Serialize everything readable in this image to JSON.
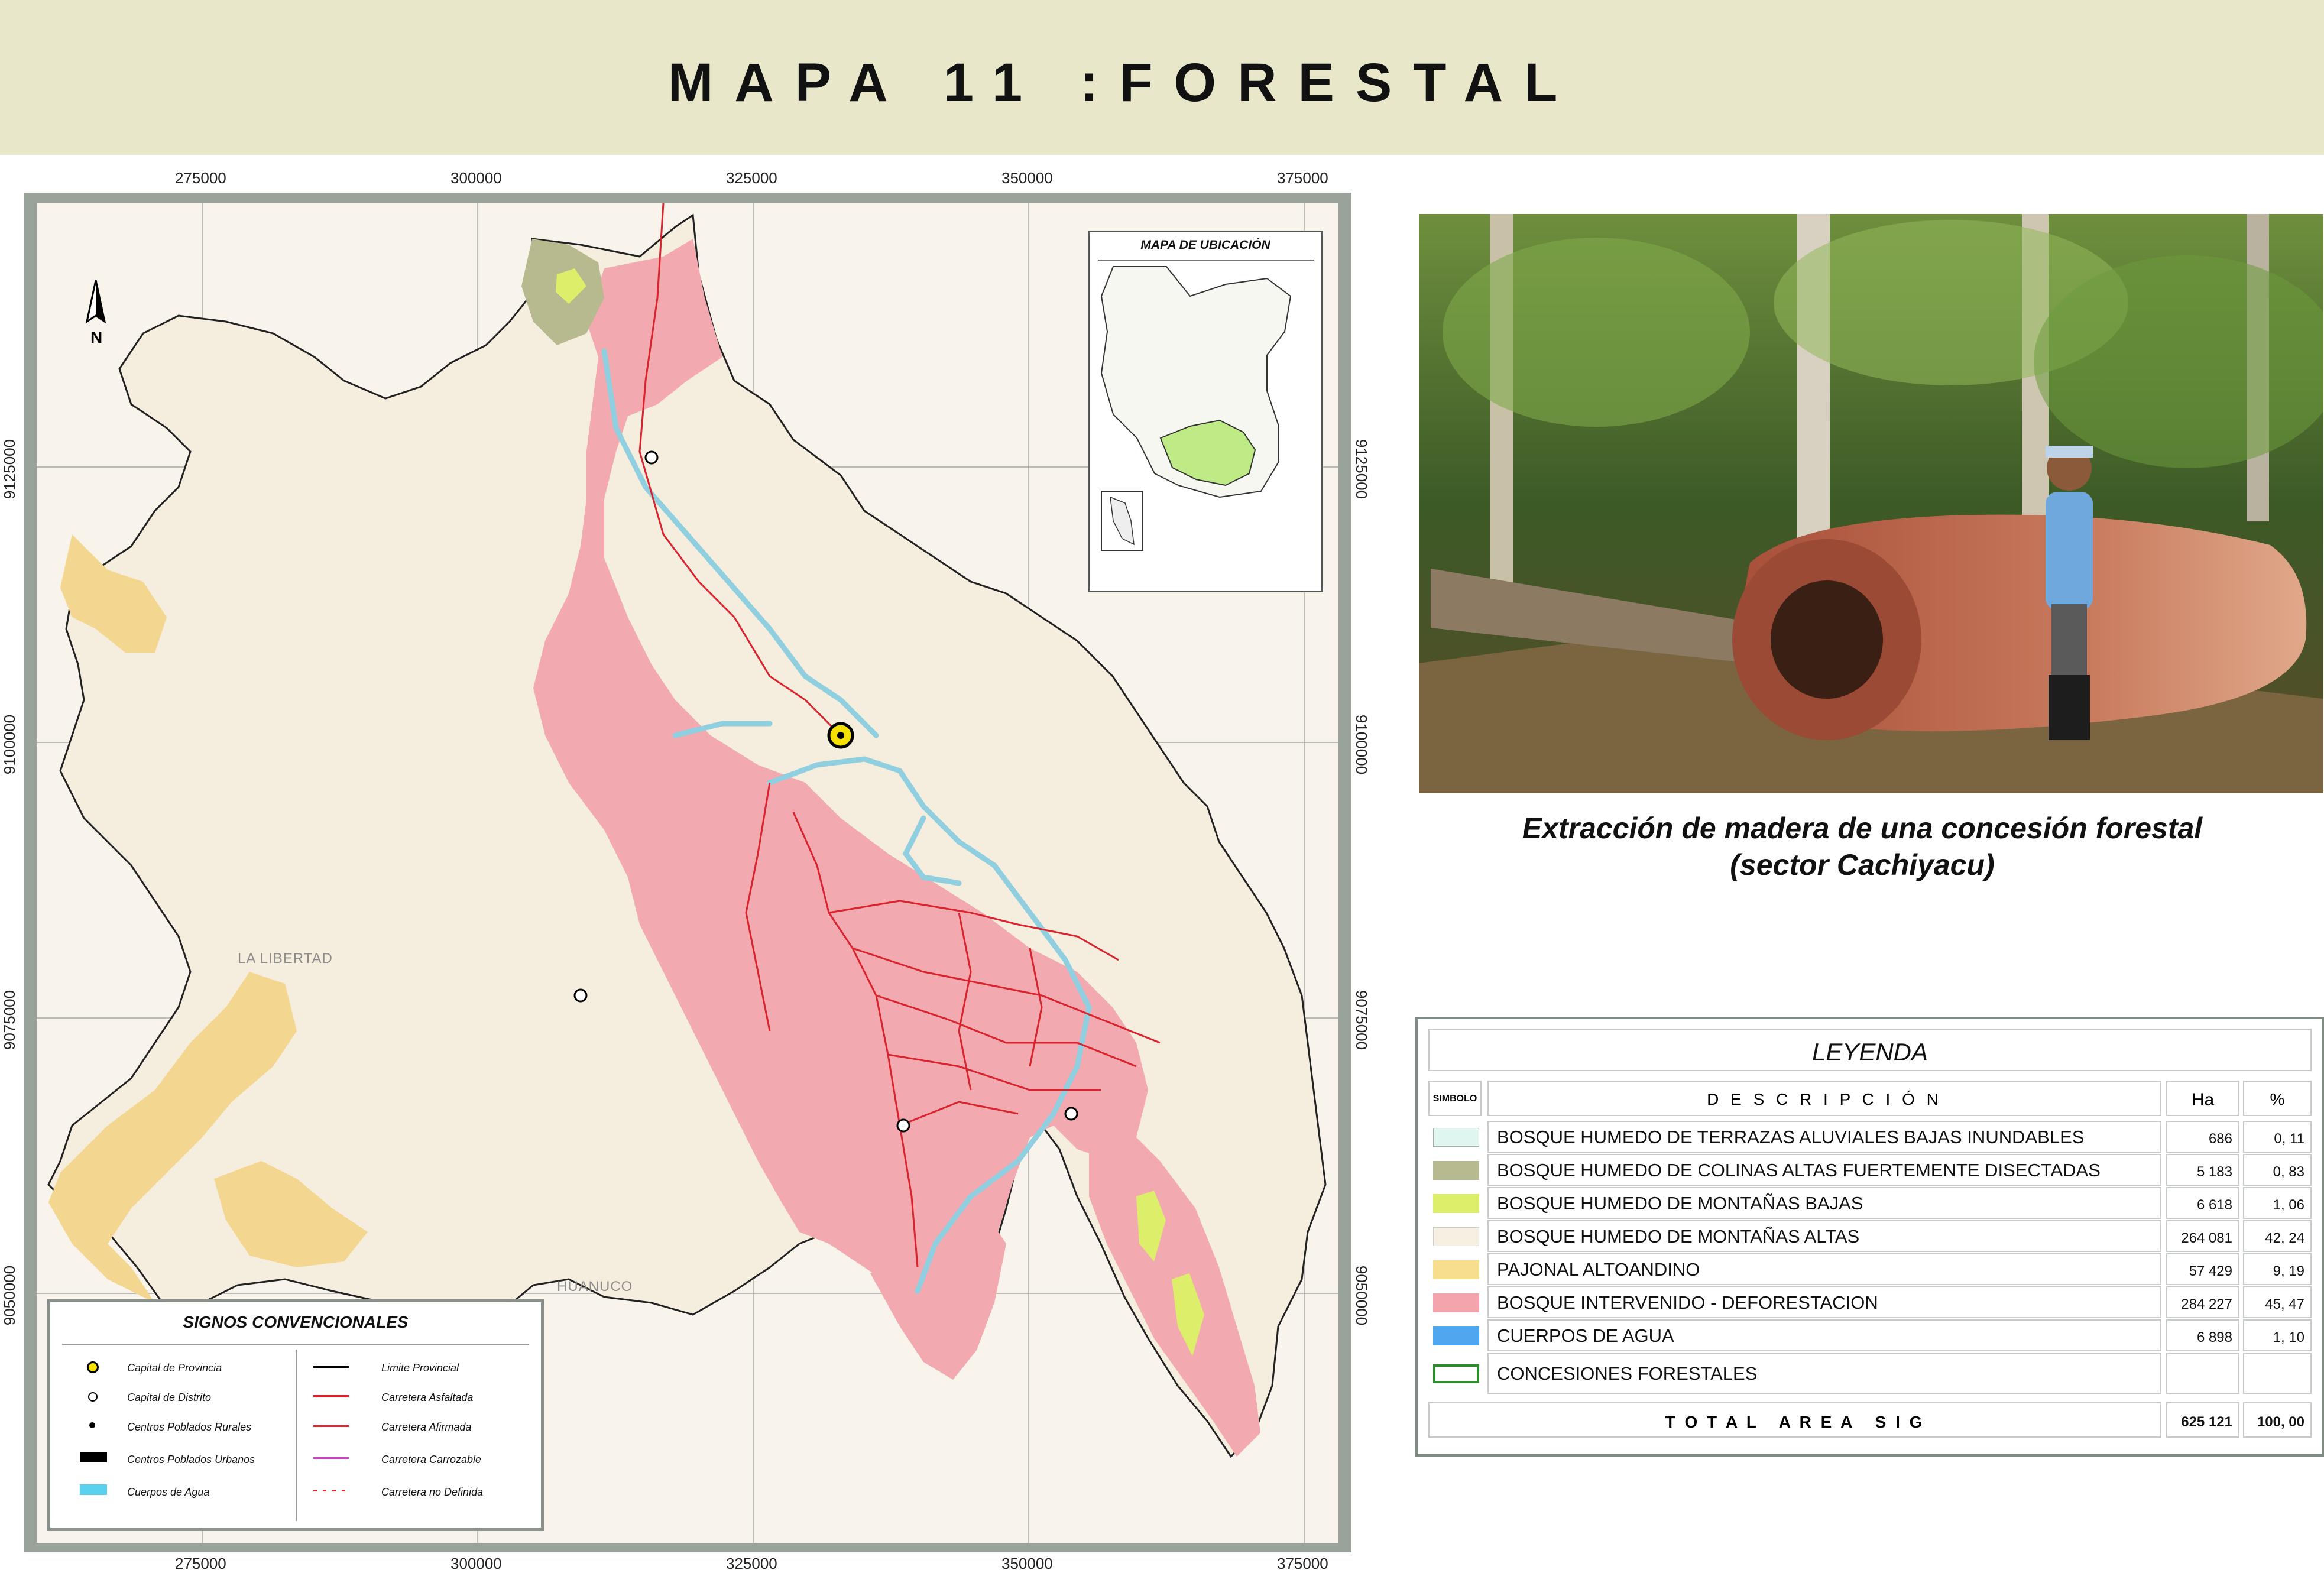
{
  "title": "MAPA 11 :FORESTAL",
  "grid": {
    "x_top": [
      "275000",
      "300000",
      "325000",
      "350000",
      "375000"
    ],
    "x_bottom": [
      "275000",
      "300000",
      "325000",
      "350000",
      "375000"
    ],
    "y_left": [
      "9125000",
      "9100000",
      "9075000",
      "9050000"
    ],
    "y_right": [
      "9125000",
      "9100000",
      "9075000",
      "9050000"
    ]
  },
  "map": {
    "north_label": "N",
    "labels": {
      "la_libertad": "LA LIBERTAD",
      "huanuco": "HUANUCO"
    },
    "colors": {
      "montanas_altas": "#f5eddd",
      "intervenido": "#f2aab0",
      "pajonal": "#f3d690",
      "colinas": "#b7ba8e",
      "montanas_bajas": "#ddee6a",
      "agua": "#8fcfe0",
      "carretera": "#d9232e",
      "limite": "#222222"
    }
  },
  "ubicacion": {
    "title": "MAPA DE UBICACIÓN",
    "highlight_color": "#bfeb86"
  },
  "photo": {
    "caption_line1": "Extracción de madera de una concesión forestal",
    "caption_line2": "(sector Cachiyacu)"
  },
  "leyenda": {
    "title": "LEYENDA",
    "col_simbolo": "SIMBOLO",
    "col_descripcion": "D E S C R I P C I Ó N",
    "col_ha": "Ha",
    "col_pct": "%",
    "rows": [
      {
        "desc": "BOSQUE HUMEDO DE TERRAZAS ALUVIALES BAJAS INUNDABLES",
        "ha": "686",
        "pct": "0, 11",
        "color": "#dff6f0"
      },
      {
        "desc": "BOSQUE HUMEDO DE COLINAS ALTAS FUERTEMENTE DISECTADAS",
        "ha": "5 183",
        "pct": "0, 83",
        "color": "#b7ba8e"
      },
      {
        "desc": "BOSQUE HUMEDO DE MONTAÑAS BAJAS",
        "ha": "6 618",
        "pct": "1, 06",
        "color": "#ddee6a"
      },
      {
        "desc": "BOSQUE HUMEDO DE MONTAÑAS ALTAS",
        "ha": "264 081",
        "pct": "42, 24",
        "color": "#f7efe2"
      },
      {
        "desc": "PAJONAL ALTOANDINO",
        "ha": "57 429",
        "pct": "9, 19",
        "color": "#f6de8e"
      },
      {
        "desc": "BOSQUE INTERVENIDO - DEFORESTACION",
        "ha": "284 227",
        "pct": "45, 47",
        "color": "#f4a4ac"
      },
      {
        "desc": "CUERPOS DE AGUA",
        "ha": "6 898",
        "pct": "1, 10",
        "color": "#4fa8ef"
      },
      {
        "desc": "CONCESIONES FORESTALES",
        "ha": "",
        "pct": "",
        "color": "outline"
      }
    ],
    "total_label": "T O T A L   A R E A   S I G",
    "total_ha": "625 121",
    "total_pct": "100, 00"
  },
  "signos": {
    "title": "SIGNOS CONVENCIONALES",
    "left": [
      "Capital de Provincia",
      "Capital de Distrito",
      "Centros Poblados Rurales",
      "Centros Poblados Urbanos",
      "Cuerpos de Agua"
    ],
    "right": [
      "Limite Provincial",
      "Carretera Asfaltada",
      "Carretera Afirmada",
      "Carretera Carrozable",
      "Carretera no Definida"
    ]
  }
}
